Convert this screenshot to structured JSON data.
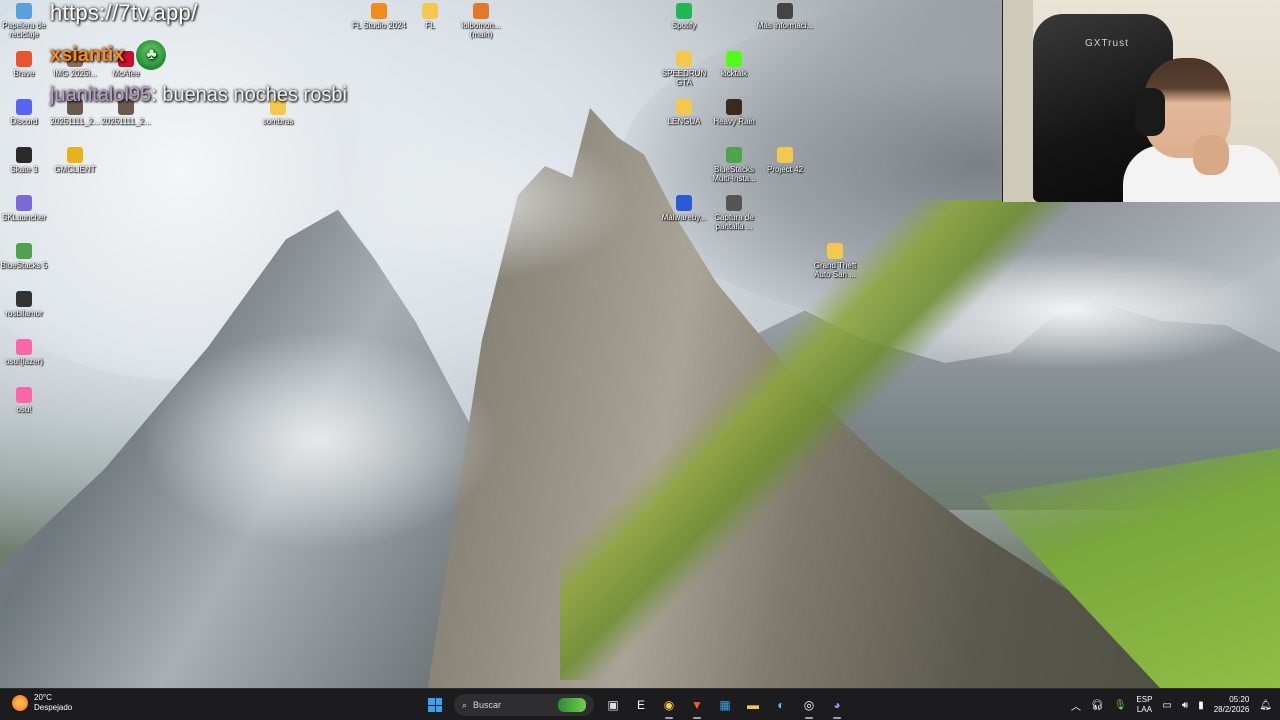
{
  "overlay": {
    "url": "https://7tv.app/",
    "chat": [
      {
        "user": "xsiantix",
        "message": ""
      },
      {
        "user": "juanitalol95",
        "message": ": buenas noches rosbi"
      }
    ]
  },
  "desktop_icons": [
    {
      "label": "Papelera de reciclaje",
      "icon": "recycle-bin-icon",
      "color": "#5aa0e0"
    },
    {
      "label": "Brave",
      "icon": "brave-icon",
      "color": "#e8552a"
    },
    {
      "label": "Discord",
      "icon": "discord-icon",
      "color": "#5865f2"
    },
    {
      "label": "Skate 3",
      "icon": "skate-icon",
      "color": "#2a2a2a"
    },
    {
      "label": "SKLauncher",
      "icon": "sklauncher-icon",
      "color": "#7a6ad8"
    },
    {
      "label": "BlueStacks 5",
      "icon": "bluestacks-icon",
      "color": "#4fa34c"
    },
    {
      "label": "rosbilamor",
      "icon": "app-icon",
      "color": "#333333"
    },
    {
      "label": "osu!(lazer)",
      "icon": "osu-icon",
      "color": "#ff66aa"
    },
    {
      "label": "osu!",
      "icon": "osu-icon",
      "color": "#ff66aa"
    },
    {
      "label": "IMG 2025l...",
      "icon": "image-icon",
      "color": "#8a6e5a"
    },
    {
      "label": "McAfee",
      "icon": "mcafee-icon",
      "color": "#c8102e"
    },
    {
      "label": "20251111_2...",
      "icon": "image-icon",
      "color": "#6a5a4e"
    },
    {
      "label": "20251111_2...",
      "icon": "image-icon",
      "color": "#6a5a4e"
    },
    {
      "label": "GMCLIENT",
      "icon": "gmclient-icon",
      "color": "#e8b21a"
    },
    {
      "label": "sombras",
      "icon": "folder-icon",
      "color": "#f2c94c"
    },
    {
      "label": "FL Studio 2024",
      "icon": "fl-studio-icon",
      "color": "#f08c1a"
    },
    {
      "label": "FL",
      "icon": "folder-icon",
      "color": "#f2c94c"
    },
    {
      "label": "lolbomon... (main)",
      "icon": "app-icon",
      "color": "#e07a2a"
    },
    {
      "label": "Spotify",
      "icon": "spotify-icon",
      "color": "#1db954"
    },
    {
      "label": "SPEEDRUN GTA",
      "icon": "folder-icon",
      "color": "#f2c94c"
    },
    {
      "label": "LENGUA",
      "icon": "folder-icon",
      "color": "#f2c94c"
    },
    {
      "label": "Malwareby...",
      "icon": "malwarebytes-icon",
      "color": "#2a5ad8"
    },
    {
      "label": "kicktalk",
      "icon": "kick-icon",
      "color": "#53fc18"
    },
    {
      "label": "Heavy Rain",
      "icon": "game-icon",
      "color": "#3a2a1a"
    },
    {
      "label": "BlueStacks Multi-Insta...",
      "icon": "bluestacks-icon",
      "color": "#4fa34c"
    },
    {
      "label": "Captura de pantalla ...",
      "icon": "image-icon",
      "color": "#555555"
    },
    {
      "label": "Más informaci...",
      "icon": "info-icon",
      "color": "#444444"
    },
    {
      "label": "Project 42",
      "icon": "folder-icon",
      "color": "#f2c94c"
    },
    {
      "label": "Grand Theft Auto San ...",
      "icon": "folder-icon",
      "color": "#f2c94c"
    }
  ],
  "webcam": {
    "chair_brand": "GXTrust"
  },
  "taskbar": {
    "weather": {
      "temp": "20°C",
      "condition": "Despejado"
    },
    "search_label": "Buscar",
    "apps": [
      {
        "icon": "file-explorer-icon",
        "glyph": "▣",
        "color": "#e0e0e0"
      },
      {
        "icon": "epic-games-icon",
        "glyph": "E",
        "color": "#ffffff"
      },
      {
        "icon": "chrome-icon",
        "glyph": "◉",
        "color": "#f2c94c"
      },
      {
        "icon": "brave-icon",
        "glyph": "▼",
        "color": "#fb542b"
      },
      {
        "icon": "store-icon",
        "glyph": "▦",
        "color": "#3aa0f0"
      },
      {
        "icon": "folder-icon",
        "glyph": "▬",
        "color": "#f2c94c"
      },
      {
        "icon": "steam-icon",
        "glyph": "◐",
        "color": "#66c0f4"
      },
      {
        "icon": "obs-icon",
        "glyph": "◎",
        "color": "#ffffff"
      },
      {
        "icon": "discord-icon",
        "glyph": "◕",
        "color": "#8c98ff"
      }
    ],
    "tray": {
      "lang_top": "ESP",
      "lang_bottom": "LAA",
      "time": "05:20",
      "date": "28/2/2026"
    }
  }
}
